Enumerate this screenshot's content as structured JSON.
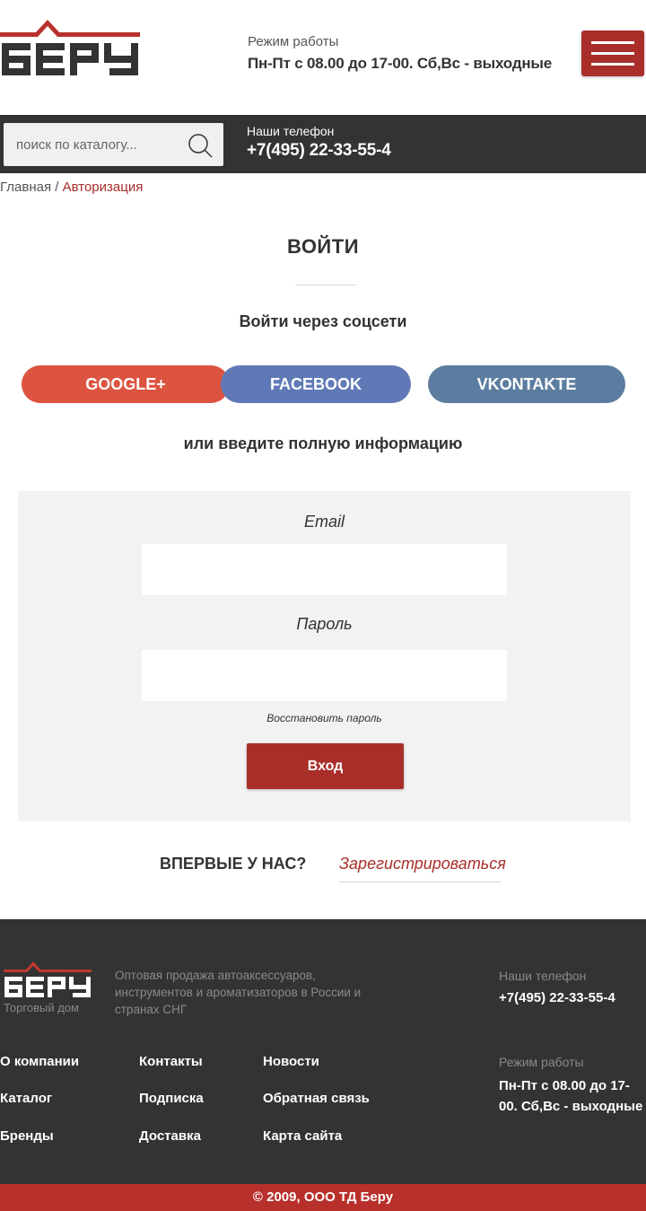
{
  "header": {
    "logo_text": "БЕРУ",
    "hours_label": "Режим работы",
    "hours_value": "Пн-Пт с 08.00 до 17-00. Сб,Вс - выходные"
  },
  "topbar": {
    "search_placeholder": "поиск по каталогу...",
    "phone_label": "Наши телефон",
    "phone_value": "+7(495) 22-33-55-4"
  },
  "breadcrumb": {
    "home": "Главная",
    "separator": " / ",
    "current": "Авторизация"
  },
  "login": {
    "title": "ВОЙТИ",
    "social_title": "Войти через соцсети",
    "social_buttons": [
      "GOOGLE+",
      "FACEBOOK",
      "VKONTAKTE"
    ],
    "or_text": "или введите полную информацию",
    "email_label": "Email",
    "password_label": "Пароль",
    "restore_link": "Восстановить пароль",
    "submit_label": "Вход",
    "first_time": "ВПЕРВЫЕ У НАС?",
    "register_link": "Зарегистрироваться"
  },
  "footer": {
    "logo_sub": "Торговый дом",
    "description": "Оптовая продажа автоаксессуаров, инструментов и ароматизаторов в России и странах СНГ",
    "phone_label": "Наши телефон",
    "phone_value": "+7(495) 22-33-55-4",
    "hours_label": "Режим работы",
    "hours_value": "Пн-Пт с 08.00 до 17-00. Сб,Вс - выходные",
    "links": [
      "О компании",
      "Контакты",
      "Новости",
      "Каталог",
      "Подписка",
      "Обратная связь",
      "Бренды",
      "Доставка",
      "Карта сайта"
    ],
    "copyright": "© 2009, ООО ТД Беру"
  },
  "colors": {
    "brand_red": "#a92e2a",
    "dark_bar": "#333333",
    "google": "#dc5440",
    "facebook": "#6079b6",
    "vkontakte": "#5c7d9f"
  }
}
